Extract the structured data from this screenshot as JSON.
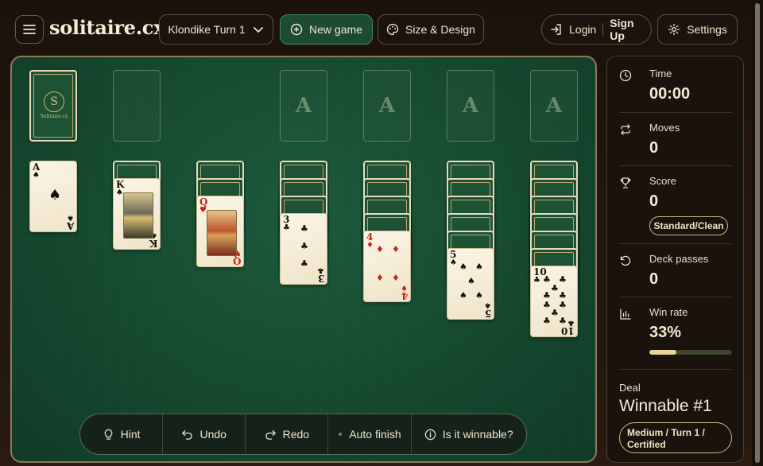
{
  "header": {
    "brand": "solitaire.cx",
    "variant_label": "Klondike Turn 1",
    "new_game_label": "New game",
    "design_label": "Size & Design",
    "login_label": "Login",
    "signup_label": "Sign Up",
    "settings_label": "Settings"
  },
  "board": {
    "stock_brand": "Solitaire.cx",
    "foundations": [
      "A",
      "A",
      "A",
      "A"
    ],
    "tableau": [
      {
        "hidden": 0,
        "top": {
          "rank": "A",
          "suit": "♠",
          "color": "black"
        }
      },
      {
        "hidden": 1,
        "top": {
          "rank": "K",
          "suit": "♠",
          "color": "black"
        }
      },
      {
        "hidden": 2,
        "top": {
          "rank": "Q",
          "suit": "♥",
          "color": "red"
        }
      },
      {
        "hidden": 3,
        "top": {
          "rank": "3",
          "suit": "♣",
          "color": "black"
        }
      },
      {
        "hidden": 4,
        "top": {
          "rank": "4",
          "suit": "♦",
          "color": "red"
        }
      },
      {
        "hidden": 5,
        "top": {
          "rank": "5",
          "suit": "♠",
          "color": "black"
        }
      },
      {
        "hidden": 6,
        "top": {
          "rank": "10",
          "suit": "♣",
          "color": "black"
        }
      }
    ]
  },
  "toolbar": {
    "hint_label": "Hint",
    "undo_label": "Undo",
    "redo_label": "Redo",
    "auto_finish_label": "Auto finish",
    "winnable_label": "Is it winnable?"
  },
  "stats": {
    "time_label": "Time",
    "time_value": "00:00",
    "moves_label": "Moves",
    "moves_value": "0",
    "score_label": "Score",
    "score_value": "0",
    "score_mode": "Standard/Clean",
    "passes_label": "Deck passes",
    "passes_value": "0",
    "winrate_label": "Win rate",
    "winrate_value": "33%",
    "winrate_fraction": 0.33
  },
  "deal": {
    "label": "Deal",
    "title": "Winnable #1",
    "badge_line1": "Medium / Turn 1 /",
    "badge_line2": "Certified"
  },
  "colors": {
    "felt": "#14482f",
    "accent": "#c9b884",
    "new_game_bg": "#1c4a33"
  }
}
